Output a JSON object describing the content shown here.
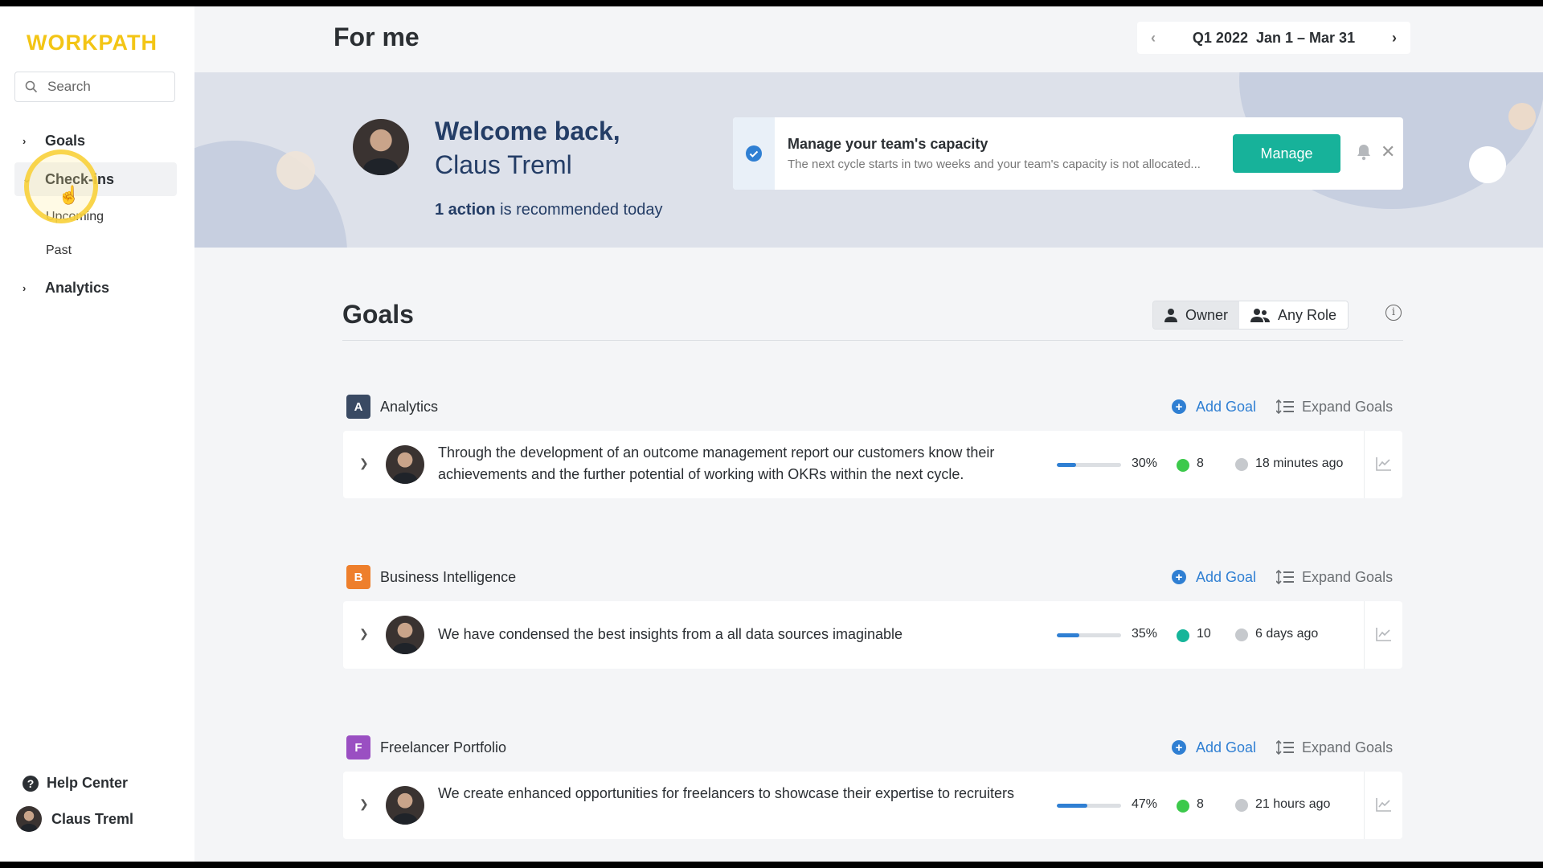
{
  "sidebar": {
    "logo": "WORKPATH",
    "search_placeholder": "Search",
    "items": [
      {
        "label": "Goals",
        "chevron": "›"
      },
      {
        "label": "Check-ins",
        "chevron": "⌄"
      },
      {
        "label": "Analytics",
        "chevron": "›"
      }
    ],
    "checkins_sub": [
      "Upcoming",
      "Past"
    ],
    "help_label": "Help Center",
    "user_name": "Claus Treml"
  },
  "header": {
    "title": "For me",
    "period_quarter": "Q1 2022",
    "period_range": "Jan 1 – Mar 31",
    "prev": "‹",
    "next": "›"
  },
  "welcome": {
    "line1": "Welcome back,",
    "line2": "Claus Treml",
    "action_count": "1 action",
    "action_rest": " is recommended today"
  },
  "notice": {
    "title": "Manage your team's capacity",
    "text": "The next cycle starts in two weeks and your team's capacity is not allocated...",
    "button": "Manage",
    "close": "✕"
  },
  "goals": {
    "title": "Goals",
    "role_owner": "Owner",
    "role_any": "Any Role",
    "info": "i",
    "add_goal": "Add Goal",
    "expand_goals": "Expand Goals",
    "groups": [
      {
        "letter": "A",
        "name": "Analytics",
        "color": "#3a4a63",
        "goal": {
          "text": "Through the development of an outcome management report our customers know their achievements and the further potential of working with OKRs within the next cycle.",
          "progress": 30,
          "progress_label": "30%",
          "count": "8",
          "status_color": "#3cc94b",
          "time": "18 minutes ago"
        }
      },
      {
        "letter": "B",
        "name": "Business Intelligence",
        "color": "#ee7f2c",
        "goal": {
          "text": "We have condensed the best insights from a all data sources imaginable",
          "progress": 35,
          "progress_label": "35%",
          "count": "10",
          "status_color": "#16b59a",
          "time": "6 days ago"
        }
      },
      {
        "letter": "F",
        "name": "Freelancer Portfolio",
        "color": "#9a4fc2",
        "goal": {
          "text": "We create enhanced opportunities for freelancers to showcase their expertise to recruiters",
          "progress": 47,
          "progress_label": "47%",
          "count": "8",
          "status_color": "#3cc94b",
          "time": "21 hours ago"
        }
      }
    ]
  }
}
